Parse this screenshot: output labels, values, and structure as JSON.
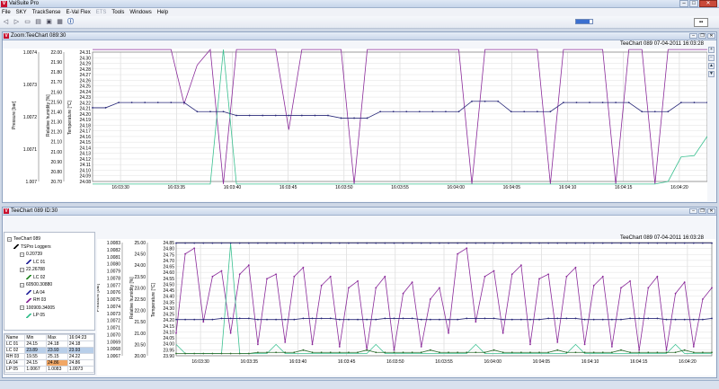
{
  "app": {
    "title": "VaiSuite Pro",
    "icon_letter": "V"
  },
  "menu": [
    "File",
    "SKY",
    "TrackSense",
    "E-Val Flex",
    "ETS",
    "Tools",
    "Windows",
    "Help"
  ],
  "menu_disabled": [
    "ETS"
  ],
  "toolbar": {
    "icons": [
      "back-icon",
      "forward-icon",
      "new-icon",
      "open-icon",
      "save-icon",
      "print-icon",
      "info-icon"
    ],
    "progress": 0.85
  },
  "zoom_window": {
    "title": "Zoom:TeeChart 089:30",
    "chart_caption": "TeeChart 089 07-04-2011 16:03:28",
    "axes": {
      "pressure": {
        "label": "Pressure [bar]",
        "ticks": [
          "1.0074",
          "1.0073",
          "1.0072",
          "1.0071",
          "1.007"
        ]
      },
      "rh": {
        "label": "Relative humidity [%]",
        "ticks": [
          "22.00",
          "21.90",
          "21.80",
          "21.70",
          "21.60",
          "21.50",
          "21.40",
          "21.30",
          "21.20",
          "21.10",
          "21.00",
          "20.90",
          "20.80",
          "20.70"
        ]
      },
      "temp": {
        "label": "Temperature [°C]",
        "ticks": [
          "24.31",
          "24.30",
          "24.29",
          "24.28",
          "24.27",
          "24.26",
          "24.25",
          "24.24",
          "24.23",
          "24.22",
          "24.21",
          "24.20",
          "24.19",
          "24.18",
          "24.17",
          "24.16",
          "24.15",
          "24.14",
          "24.13",
          "24.12",
          "24.11",
          "24.10",
          "24.09",
          "24.08"
        ]
      },
      "x_ticks": [
        "16:03:30",
        "16:03:35",
        "16:03:40",
        "16:03:45",
        "16:03:50",
        "16:03:55",
        "16:04:00",
        "16:04:05",
        "16:04:10",
        "16:04:15",
        "16:04:20"
      ]
    }
  },
  "main_window": {
    "title": "TeeChart 089 ID:30",
    "chart_caption": "TeeChart 089 07-04-2011 16:03:28",
    "axes": {
      "pressure": {
        "label": "Pressure [bar]",
        "ticks": [
          "1.0083",
          "1.0082",
          "1.0081",
          "1.0080",
          "1.0079",
          "1.0078",
          "1.0077",
          "1.0076",
          "1.0075",
          "1.0074",
          "1.0073",
          "1.0072",
          "1.0071",
          "1.0070",
          "1.0069",
          "1.0068",
          "1.0067"
        ]
      },
      "rh": {
        "label": "Relative humidity [%]",
        "ticks": [
          "25.00",
          "24.50",
          "24.00",
          "23.50",
          "23.00",
          "22.50",
          "22.00",
          "21.50",
          "21.00",
          "20.50",
          "20.00"
        ]
      },
      "temp": {
        "label": "Temperature [°C]",
        "ticks": [
          "24.85",
          "24.80",
          "24.75",
          "24.70",
          "24.65",
          "24.60",
          "24.55",
          "24.50",
          "24.45",
          "24.40",
          "24.35",
          "24.30",
          "24.25",
          "24.20",
          "24.15",
          "24.10",
          "24.05",
          "24.00",
          "23.95",
          "23.90"
        ]
      },
      "x_ticks": [
        "16:03:30",
        "16:03:35",
        "16:03:40",
        "16:03:45",
        "16:03:50",
        "16:03:55",
        "16:04:00",
        "16:04:05",
        "16:04:10",
        "16:04:15",
        "16:04:20"
      ]
    },
    "tree": [
      {
        "label": "TeeChart 089",
        "level": 0,
        "color": "#666666",
        "kind": "root"
      },
      {
        "label": "TSPro Loggers",
        "level": 1,
        "color": "#000000",
        "kind": "group"
      },
      {
        "label": "0.20739",
        "level": 2,
        "color": "#444444",
        "kind": "box"
      },
      {
        "label": "LC 01",
        "level": 3,
        "color": "#2a2a9a",
        "kind": "series"
      },
      {
        "label": "22.26788",
        "level": 2,
        "color": "#444444",
        "kind": "box"
      },
      {
        "label": "LC 02",
        "level": 3,
        "color": "#2a8a2a",
        "kind": "series"
      },
      {
        "label": "60500.30880",
        "level": 2,
        "color": "#444444",
        "kind": "box"
      },
      {
        "label": "LA 04",
        "level": 3,
        "color": "#3030a0",
        "kind": "series"
      },
      {
        "label": "RH 03",
        "level": 3,
        "color": "#8a2a9a",
        "kind": "series"
      },
      {
        "label": "100909.34005",
        "level": 2,
        "color": "#444444",
        "kind": "box"
      },
      {
        "label": "LP 05",
        "level": 3,
        "color": "#3ac090",
        "kind": "series"
      }
    ],
    "stats": {
      "headers": [
        "Name",
        "Min",
        "Max",
        "16:04:23"
      ],
      "rows": [
        [
          "LC 01",
          "24.15",
          "24.18",
          "24.18"
        ],
        [
          "LC 02",
          "23.89",
          "23.93",
          "23.93"
        ],
        [
          "RH 03",
          "19.55",
          "25.15",
          "24.22"
        ],
        [
          "LA 04",
          "24.15",
          "24.86",
          "24.86"
        ],
        [
          "LP 05",
          "1.0067",
          "1.0083",
          "1.0073"
        ]
      ]
    }
  },
  "colors": {
    "pressure": "#3ac090",
    "rh": "#8a2a9a",
    "temp_a": "#2a2a7a",
    "temp_b": "#2a6a2a"
  }
}
